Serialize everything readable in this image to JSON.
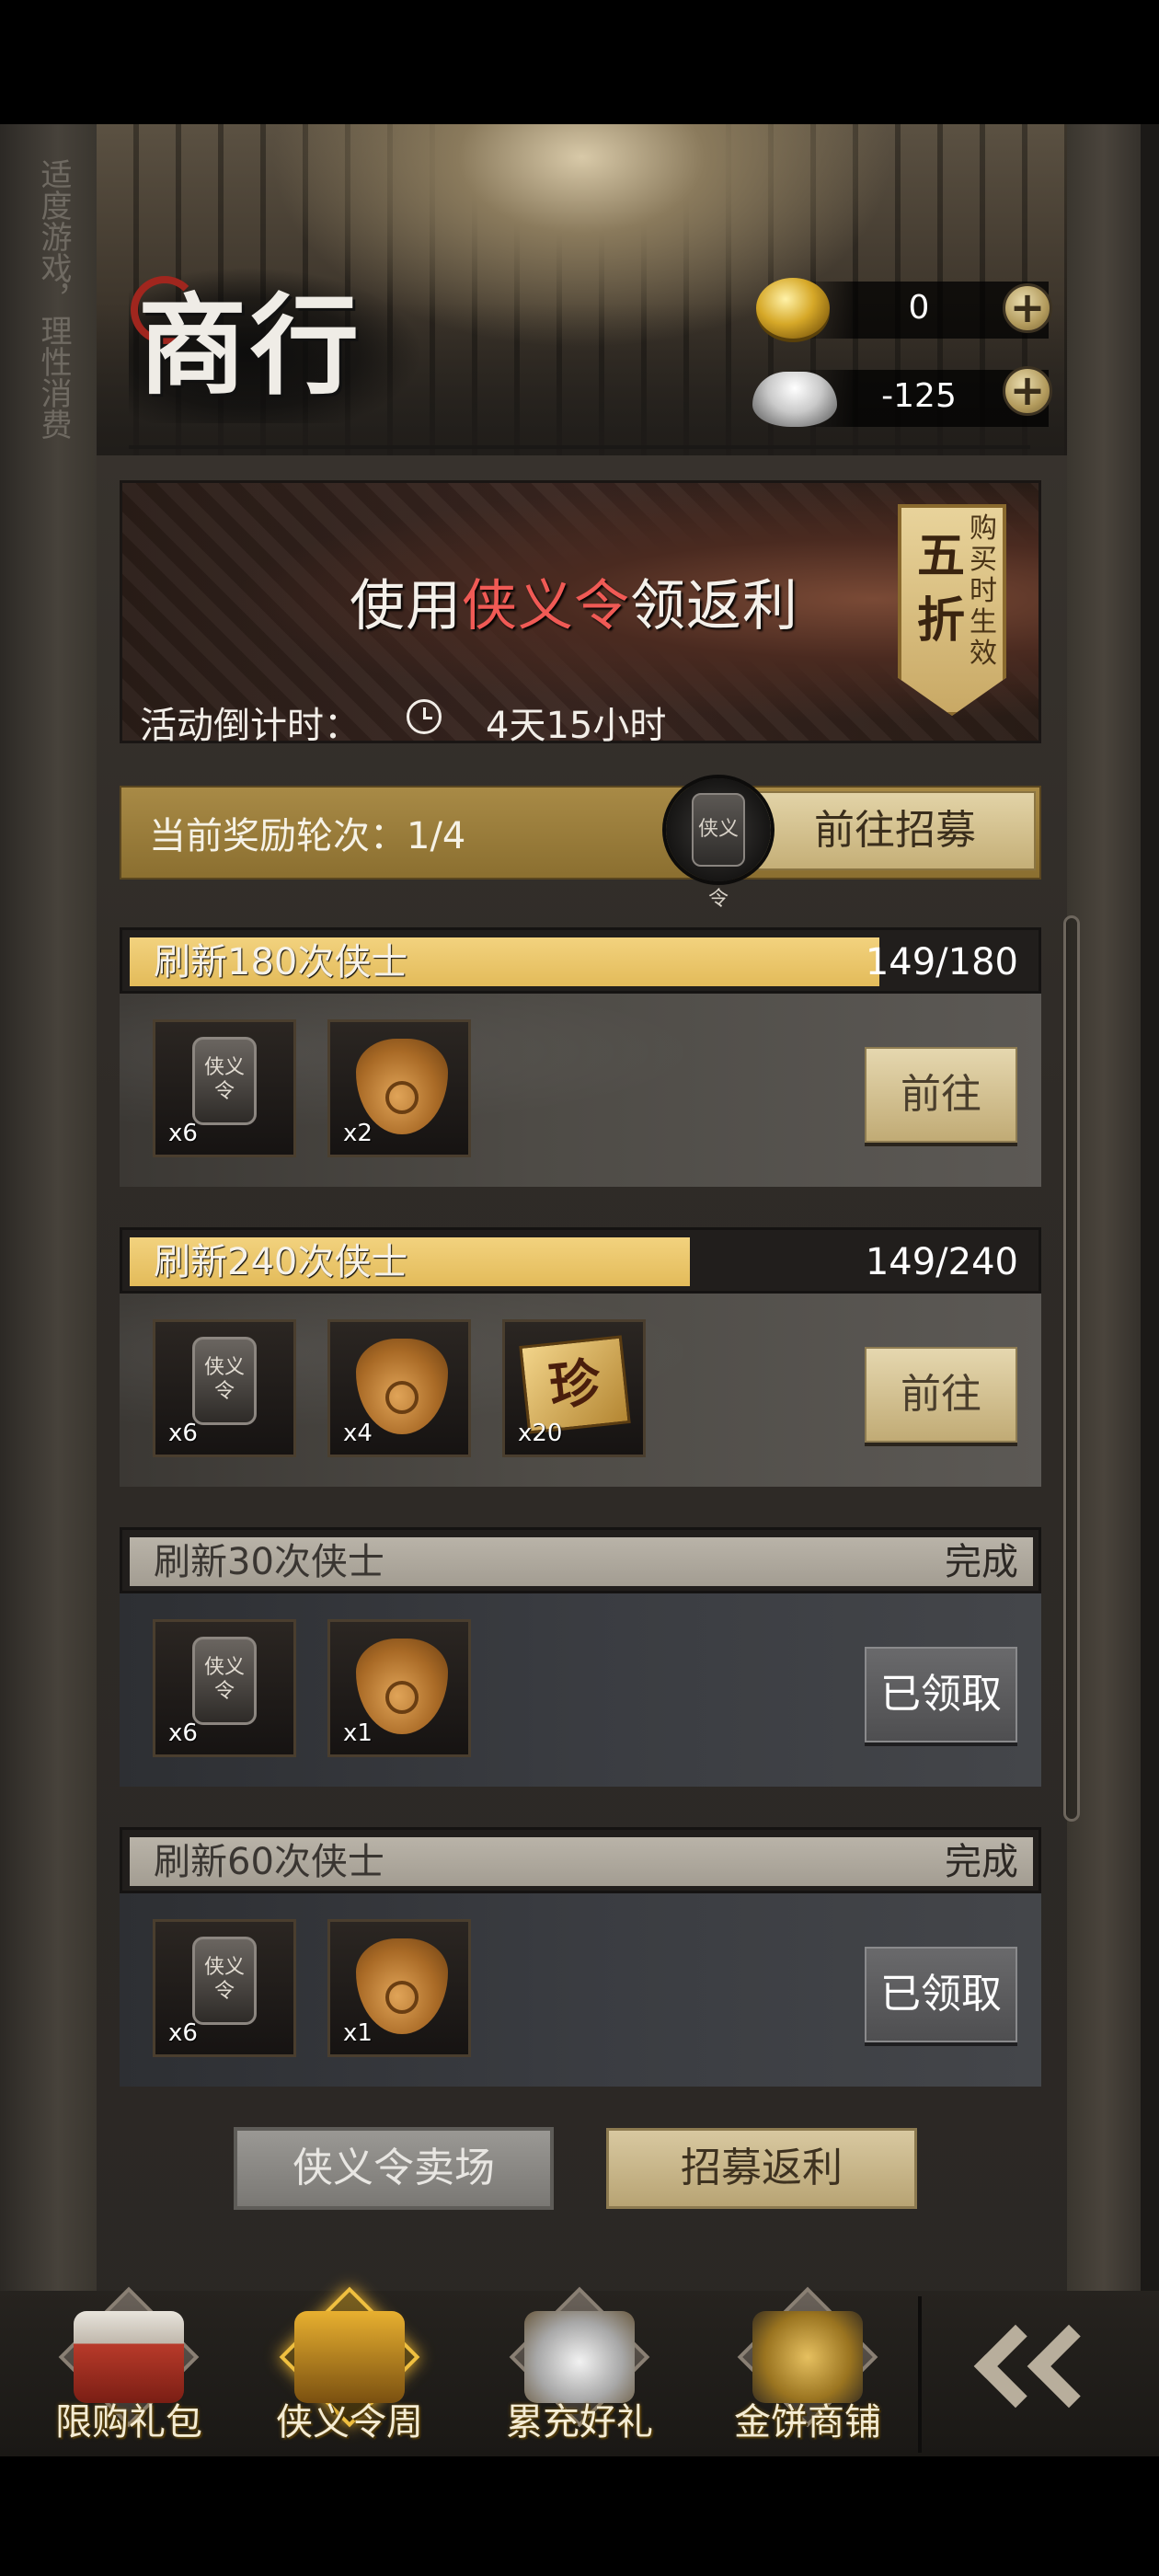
{
  "advice": "适度游戏，理性消费",
  "header": {
    "title": "商行",
    "currencies": [
      {
        "icon": "gold-coin-icon",
        "value": "0"
      },
      {
        "icon": "silver-ingot-icon",
        "value": "-125"
      }
    ],
    "plus": "+"
  },
  "banner": {
    "headline_pre": "使用",
    "headline_highlight": "侠义令",
    "headline_post": "领返利",
    "discount_big": "五折",
    "discount_small": "购买时生效",
    "countdown_label": "活动倒计时：",
    "countdown_value": "4天15小时"
  },
  "round": {
    "label": "当前奖励轮次：1/4",
    "token_text": "侠义令",
    "button": "前往招募"
  },
  "tasks": [
    {
      "title": "刷新180次侠士",
      "progress": "149/180",
      "fill": 0.83,
      "status": "active",
      "button": "前往",
      "items": [
        {
          "type": "token",
          "count": "x6"
        },
        {
          "type": "bag",
          "count": "x2"
        }
      ]
    },
    {
      "title": "刷新240次侠士",
      "progress": "149/240",
      "fill": 0.62,
      "status": "active",
      "button": "前往",
      "items": [
        {
          "type": "token",
          "count": "x6"
        },
        {
          "type": "bag",
          "count": "x4"
        },
        {
          "type": "zhen",
          "count": "x20"
        }
      ]
    },
    {
      "title": "刷新30次侠士",
      "progress": "完成",
      "fill": 1.0,
      "status": "claimed",
      "button": "已领取",
      "items": [
        {
          "type": "token",
          "count": "x6"
        },
        {
          "type": "bag",
          "count": "x1"
        }
      ]
    },
    {
      "title": "刷新60次侠士",
      "progress": "完成",
      "fill": 1.0,
      "status": "claimed",
      "button": "已领取",
      "items": [
        {
          "type": "token",
          "count": "x6"
        },
        {
          "type": "bag",
          "count": "x1"
        }
      ]
    }
  ],
  "item_glyphs": {
    "token": "侠义令",
    "zhen": "珍"
  },
  "bottom_tabs": {
    "token_market": "侠义令卖场",
    "recruit_rebate": "招募返利"
  },
  "nav": [
    {
      "label": "限购礼包",
      "icon": "gift-box-icon",
      "active": false
    },
    {
      "label": "侠义令周",
      "icon": "token-week-icon",
      "active": true
    },
    {
      "label": "累充好礼",
      "icon": "ingot-bowl-icon",
      "active": false
    },
    {
      "label": "金饼商铺",
      "icon": "gold-cake-icon",
      "active": false
    }
  ],
  "colors": {
    "gold_fill": "#e3bb5a",
    "highlight_red": "#f05a55",
    "active_nav": "#f0c040"
  }
}
